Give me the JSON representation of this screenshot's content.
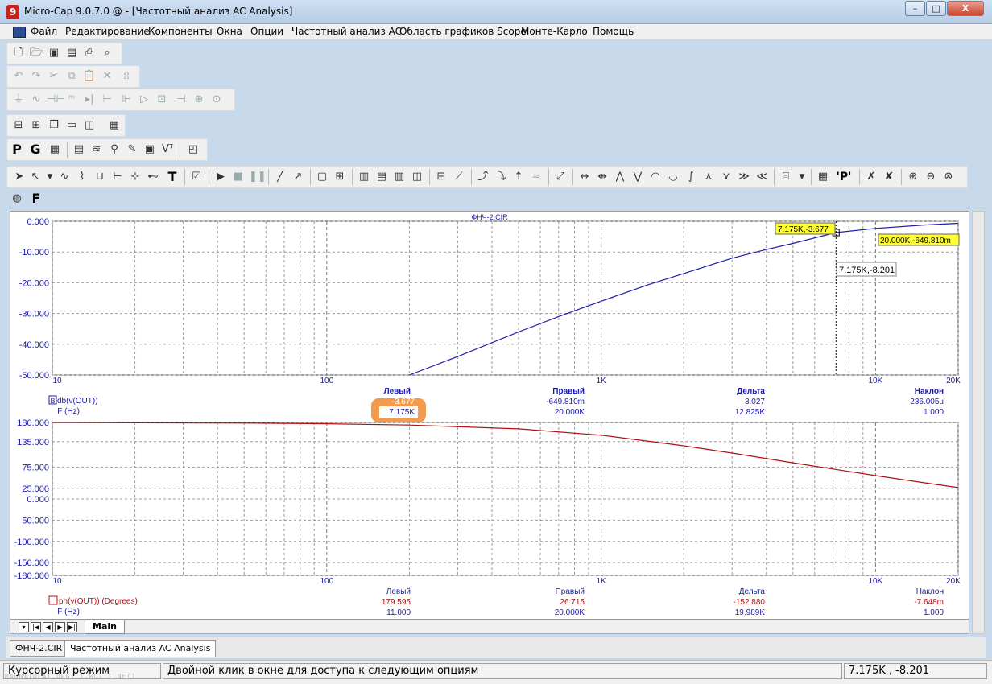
{
  "window": {
    "title": "Micro-Cap 9.0.7.0 @ - [Частотный анализ AC Analysis]",
    "app_icon_glyph": "9",
    "min": "–",
    "max": "□",
    "close": "X"
  },
  "menu": [
    "Файл",
    "Редактирование",
    "Компоненты",
    "Окна",
    "Опции",
    "Частотный анализ AC",
    "Область графиков Scope",
    "Монте-Карло",
    "Помощь"
  ],
  "toolbar": {
    "letters": {
      "p": "P",
      "g": "G",
      "f": "F",
      "text_tool": "T",
      "p_quote": "'P'"
    }
  },
  "plot": {
    "title": "ФНЧ-2.CIR",
    "upper": {
      "y_ticks": [
        "0.000",
        "-10.000",
        "-20.000",
        "-30.000",
        "-40.000",
        "-50.000"
      ],
      "x_ticks": [
        "10",
        "100",
        "1K",
        "10K",
        "20K"
      ],
      "cursor_label": "7.175K,-3.677",
      "end_label": "20.000K,-649.810m",
      "hover_label": "7.175K,-8.201",
      "headers": [
        "Левый",
        "Правый",
        "Дельта",
        "Наклон"
      ],
      "trace_name": "db(v(OUT))",
      "trace_marker": "B",
      "trace_values": [
        "-3.677",
        "-649.810m",
        "3.027",
        "236.005u"
      ],
      "x_name": "F (Hz)",
      "x_values": [
        "7.175K",
        "20.000K",
        "12.825K",
        "1.000"
      ]
    },
    "lower": {
      "y_ticks": [
        "180.000",
        "135.000",
        "75.000",
        "25.000",
        "0.000",
        "-50.000",
        "-100.000",
        "-150.000",
        "-180.000"
      ],
      "x_ticks": [
        "10",
        "100",
        "1K",
        "10K",
        "20K"
      ],
      "headers": [
        "Левый",
        "Правый",
        "Дельта",
        "Наклон"
      ],
      "trace_name": "ph(v(OUT)) (Degrees)",
      "trace_values": [
        "179.595",
        "26.715",
        "-152.880",
        "-7.648m"
      ],
      "x_name": "F (Hz)",
      "x_values": [
        "11.000",
        "20.000K",
        "19.989K",
        "1.000"
      ]
    },
    "colors": {
      "magnitude": "#1c1caa",
      "phase": "#b01010",
      "highlight": "#f08a30"
    }
  },
  "chart_data": [
    {
      "type": "line",
      "title": "ФНЧ-2.CIR",
      "xlabel": "F (Hz)",
      "x_scale": "log",
      "xlim": [
        10,
        20000
      ],
      "ylim": [
        -50,
        0
      ],
      "grid": true,
      "series": [
        {
          "name": "db(v(OUT))",
          "x": [
            200,
            300,
            500,
            700,
            1000,
            1500,
            2000,
            3000,
            4000,
            5000,
            7175,
            10000,
            15000,
            20000
          ],
          "y": [
            -50,
            -44,
            -36,
            -31,
            -26,
            -20.5,
            -17,
            -12,
            -9.2,
            -7.2,
            -3.677,
            -2.3,
            -1.2,
            -0.65
          ]
        }
      ]
    },
    {
      "type": "line",
      "xlabel": "F (Hz)",
      "x_scale": "log",
      "xlim": [
        10,
        20000
      ],
      "ylim": [
        -180,
        180
      ],
      "grid": true,
      "series": [
        {
          "name": "ph(v(OUT)) (Degrees)",
          "x": [
            10,
            11,
            50,
            100,
            200,
            500,
            1000,
            2000,
            3000,
            5000,
            10000,
            15000,
            20000
          ],
          "y": [
            179.8,
            179.595,
            178.5,
            177,
            174,
            165,
            150,
            125,
            108,
            85,
            55,
            38,
            26.715
          ]
        }
      ]
    }
  ],
  "tabs": {
    "main": "Main",
    "docs": [
      "ФНЧ-2.CIR",
      "Частотный анализ AC Analysis"
    ]
  },
  "status": {
    "mode": "Курсорный режим",
    "hint": "Двойной клик в окне для доступа к следующим опциям",
    "coords": "7.175K , -8.201"
  },
  "watermark": "MAGNITOLA[.ORG] [.RU] [.NET]"
}
